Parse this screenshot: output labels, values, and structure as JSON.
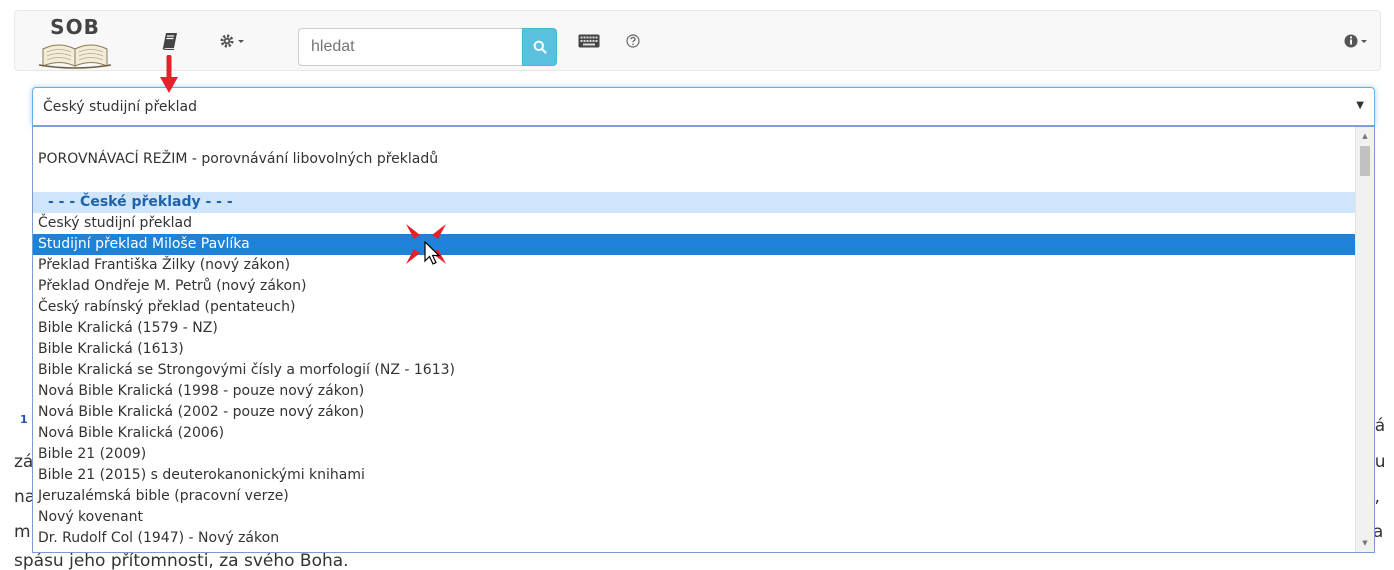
{
  "app": {
    "logo_text": "SOB"
  },
  "toolbar": {
    "search_placeholder": "hledat",
    "icons": [
      "book-icon",
      "gear-icon",
      "search-icon",
      "keyboard-icon",
      "help-icon",
      "info-icon"
    ]
  },
  "select": {
    "value": "Český studijní překlad"
  },
  "dropdown": {
    "compare_mode": "POROVNÁVACÍ REŽIM - porovnávání libovolných překladů",
    "group_label": "- - - České překlady - - -",
    "items": [
      "Český studijní překlad",
      "Studijní překlad Miloše Pavlíka",
      "Překlad Františka Žilky (nový zákon)",
      "Překlad Ondřeje M. Petrů (nový zákon)",
      "Český rabínský překlad (pentateuch)",
      "Bible Kralická (1579 - NZ)",
      "Bible Kralická (1613)",
      "Bible Kralická se Strongovými čísly a morfologií (NZ - 1613)",
      "Nová Bible Kralická (1998 - pouze nový zákon)",
      "Nová Bible Kralická (2002 - pouze nový zákon)",
      "Nová Bible Kralická (2006)",
      "Bible 21 (2009)",
      "Bible 21 (2015) s deuterokanonickými knihami",
      "Jeruzalémská bible (pracovní verze)",
      "Nový kovenant",
      "Dr. Rudolf Col (1947) - Nový zákon"
    ],
    "selected_index": 1
  },
  "background_text": {
    "verse_number": "1",
    "line1_right": "ná",
    "line2_left": "zá",
    "line2_right": "pu",
    "line3_left": "na",
    "line3_right": "e,",
    "line4_left": "m",
    "line4_right": "za",
    "line5": "spásu jeho přítomnosti, za svého Boha."
  },
  "colors": {
    "accent": "#5bc0de",
    "selection": "#1e82d8",
    "group_bg": "#cfe5fb",
    "group_text": "#1d62ad",
    "annotation_red": "#e8202a"
  }
}
